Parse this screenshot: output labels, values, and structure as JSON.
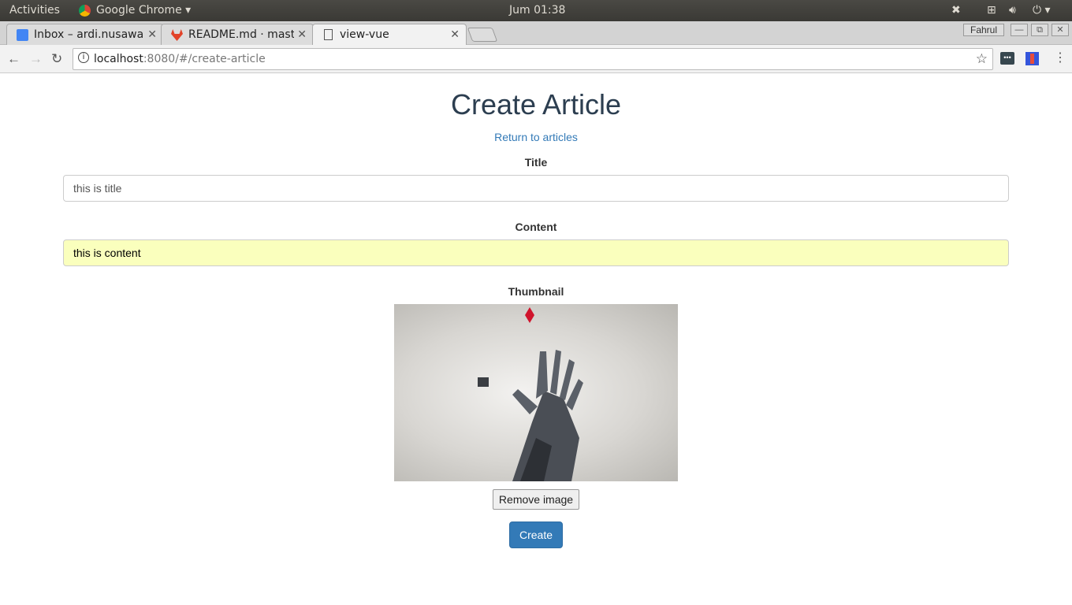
{
  "system_bar": {
    "activities": "Activities",
    "app": "Google Chrome",
    "clock": "Jum 01:38"
  },
  "tabs": [
    {
      "label": "Inbox – ardi.nusawa",
      "icon": "inbox-icon"
    },
    {
      "label": "README.md · mast",
      "icon": "gitlab-icon"
    },
    {
      "label": "view-vue",
      "icon": "page-icon",
      "active": true
    }
  ],
  "window": {
    "user": "Fahrul"
  },
  "address": {
    "host": "localhost",
    "path": ":8080/#/create-article"
  },
  "page": {
    "title": "Create Article",
    "return_link": "Return to articles",
    "title_label": "Title",
    "title_value": "this is title",
    "content_label": "Content",
    "content_value": "this is content",
    "thumbnail_label": "Thumbnail",
    "remove_button": "Remove image",
    "create_button": "Create"
  },
  "colors": {
    "primary": "#337ab7",
    "heading": "#2c3e50",
    "autofill": "#faffbd"
  }
}
